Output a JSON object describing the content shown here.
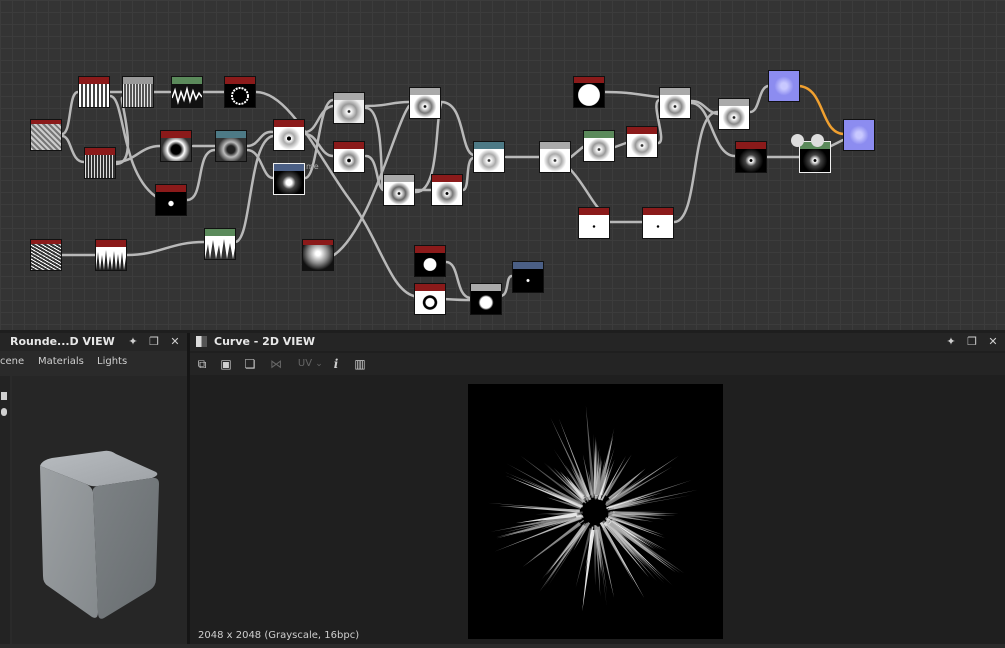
{
  "graph": {
    "hint_label": "me"
  },
  "left_panel": {
    "title": "Rounde...D VIEW",
    "tabs": [
      "cene",
      "Materials",
      "Lights"
    ]
  },
  "right_panel": {
    "title": "Curve - 2D VIEW",
    "toolbar": {
      "uv_label": "UV",
      "uv_caret": "⌄",
      "info_label": "i"
    },
    "status": "2048 x 2048 (Grayscale, 16bpc)"
  },
  "icons": {
    "pin": "pin-icon",
    "maximize": "maximize-icon",
    "close": "close-icon"
  },
  "colors": {
    "header_red": "#8b1a1a",
    "header_green": "#5b8a5b",
    "header_blue": "#4b5f85",
    "header_teal": "#4d7a86",
    "output_purple": "#8c8cf0",
    "link_orange": "#f0a030"
  }
}
